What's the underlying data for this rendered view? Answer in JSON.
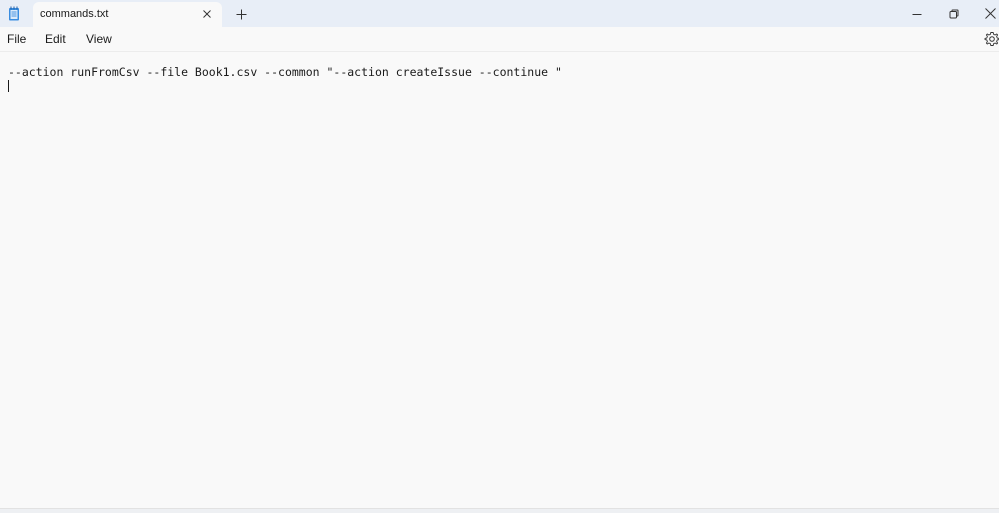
{
  "titlebar": {
    "app_icon": "notepad-icon",
    "tab": {
      "title": "commands.txt",
      "close_icon": "close-icon"
    },
    "new_tab_icon": "plus-icon",
    "window_controls": [
      "minimize-icon",
      "restore-icon",
      "close-icon"
    ]
  },
  "menubar": {
    "file_label": "File",
    "edit_label": "Edit",
    "view_label": "View",
    "settings_icon": "gear-icon"
  },
  "editor": {
    "lines": [
      "--action runFromCsv --file Book1.csv --common \"--action createIssue --continue \"",
      ""
    ]
  },
  "colors": {
    "titlebar_bg": "#e8eef7",
    "editor_bg": "#f9f9f9",
    "text": "#1a1a1a"
  }
}
